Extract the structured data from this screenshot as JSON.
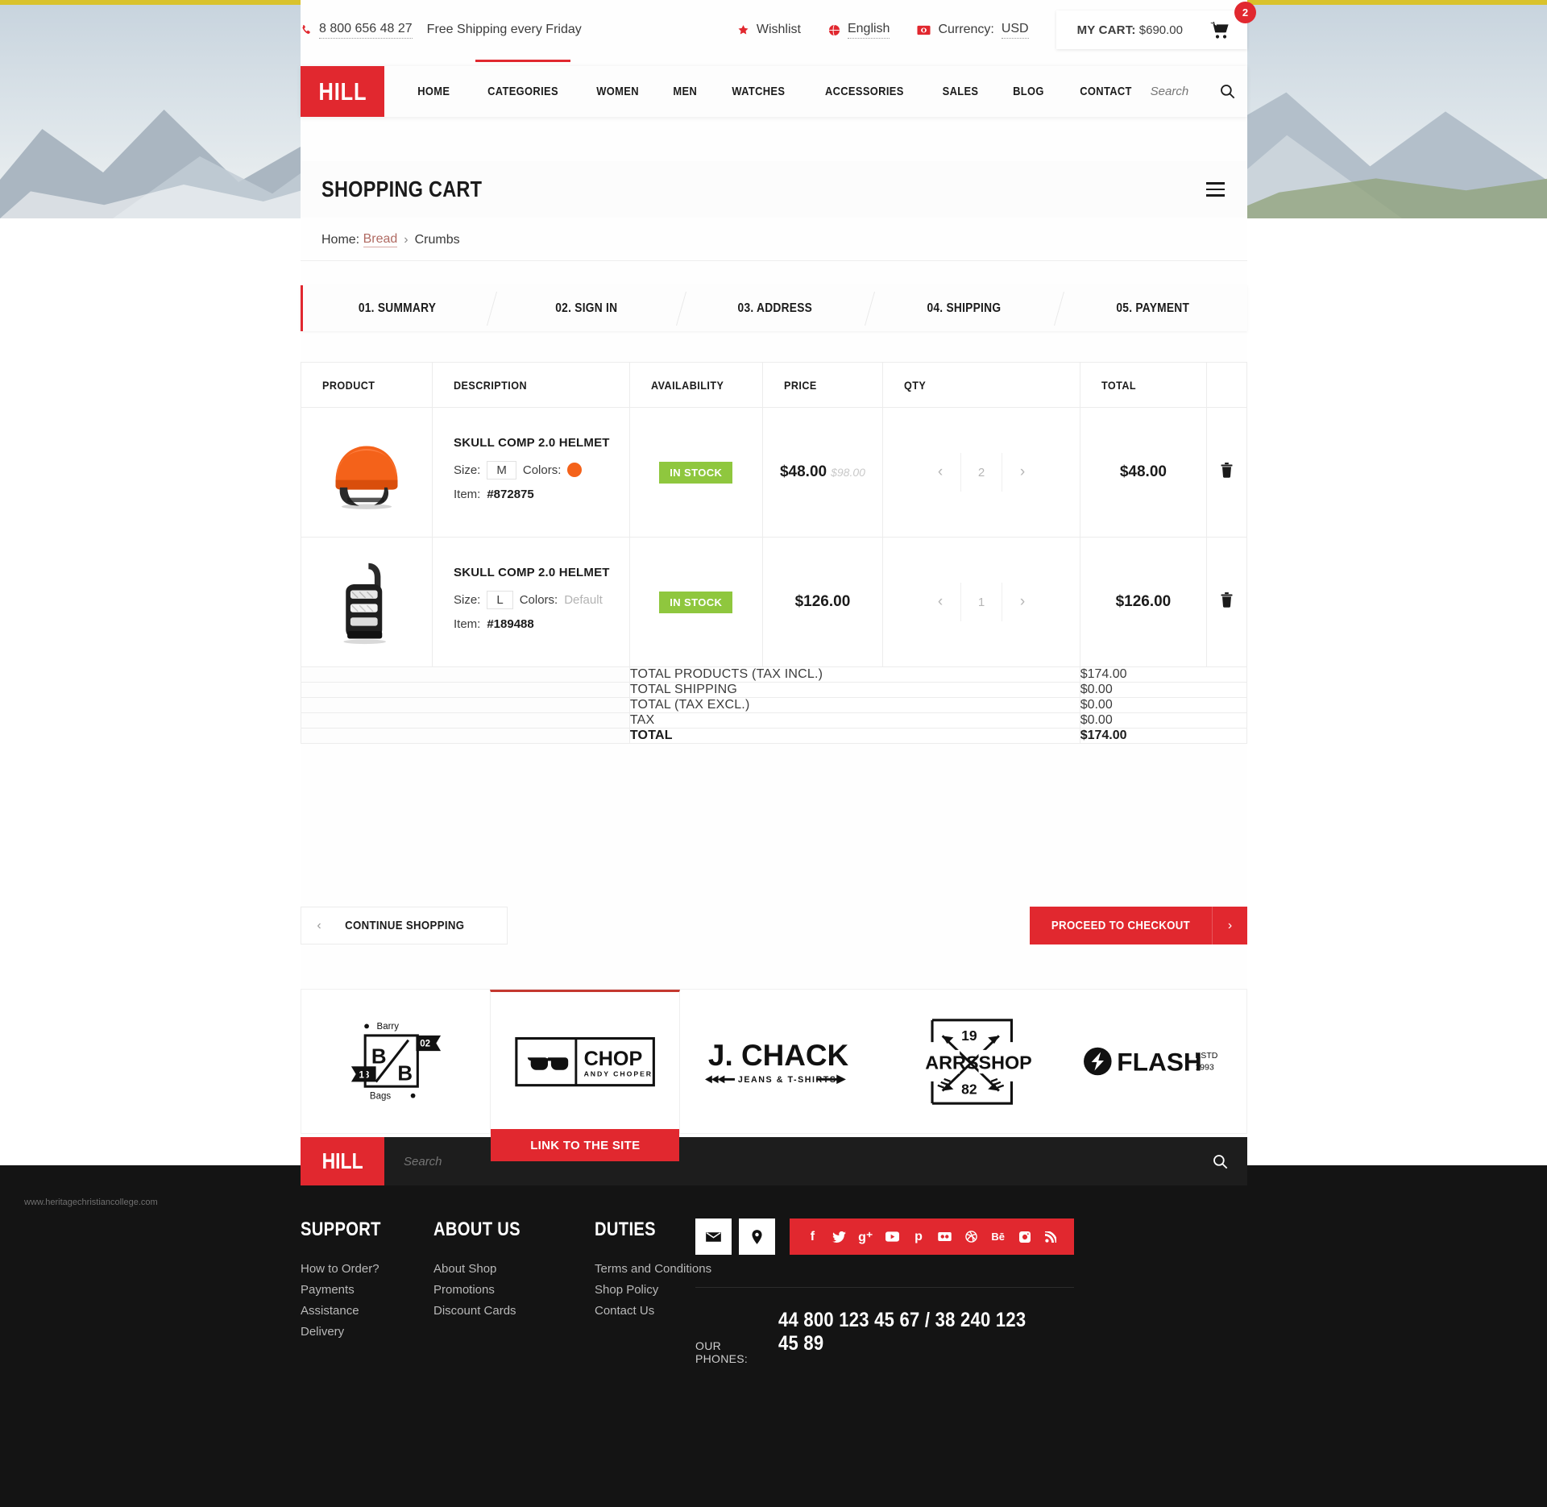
{
  "utility": {
    "phone": "8 800 656 48 27",
    "shipping_note": "Free Shipping every Friday",
    "wishlist": "Wishlist",
    "language": "English",
    "currency_label": "Currency:",
    "currency_value": "USD",
    "cart_label": "MY CART:",
    "cart_total": "$690.00",
    "cart_count": "2",
    "phone_icon": "phone-icon",
    "wishlist_icon": "star-icon",
    "language_icon": "globe-icon",
    "currency_icon": "money-icon",
    "cart_icon": "cart-icon"
  },
  "nav": {
    "logo": "HILL",
    "items": [
      {
        "label": "HOME",
        "active": false
      },
      {
        "label": "CATEGORIES",
        "active": true
      },
      {
        "label": "WOMEN",
        "active": false
      },
      {
        "label": "MEN",
        "active": false
      },
      {
        "label": "WATCHES",
        "active": false
      },
      {
        "label": "ACCESSORIES",
        "active": false
      },
      {
        "label": "SALES",
        "active": false
      },
      {
        "label": "BLOG",
        "active": false
      },
      {
        "label": "CONTACT",
        "active": false
      }
    ],
    "search_placeholder": "Search",
    "search_icon": "search-icon"
  },
  "page": {
    "title": "SHOPPING CART",
    "menu_icon": "hamburger-icon"
  },
  "breadcrumb": {
    "prefix": "Home:",
    "link": "Bread",
    "separator": "›",
    "current": "Crumbs"
  },
  "steps": [
    {
      "label": "01. SUMMARY",
      "active": true
    },
    {
      "label": "02. SIGN IN",
      "active": false
    },
    {
      "label": "03. ADDRESS",
      "active": false
    },
    {
      "label": "04. SHIPPING",
      "active": false
    },
    {
      "label": "05. PAYMENT",
      "active": false
    }
  ],
  "table": {
    "headers": [
      "PRODUCT",
      "DESCRIPTION",
      "AVAILABILITY",
      "PRICE",
      "QTY",
      "TOTAL",
      ""
    ],
    "rows": [
      {
        "image": "orange-helmet-image",
        "name": "SKULL COMP 2.0 HELMET",
        "size_label": "Size:",
        "size": "M",
        "colors_label": "Colors:",
        "color_value": "",
        "color_hex": "#f4621a",
        "item_label": "Item:",
        "item": "#872875",
        "availability": "IN STOCK",
        "price": "$48.00",
        "price_old": "$98.00",
        "qty": "2",
        "total": "$48.00",
        "delete_icon": "trash-icon"
      },
      {
        "image": "snowboard-binding-image",
        "name": "SKULL COMP 2.0 HELMET",
        "size_label": "Size:",
        "size": "L",
        "colors_label": "Colors:",
        "color_value": "Default",
        "color_hex": "",
        "item_label": "Item:",
        "item": "#189488",
        "availability": "IN STOCK",
        "price": "$126.00",
        "price_old": "",
        "qty": "1",
        "total": "$126.00",
        "delete_icon": "trash-icon"
      }
    ],
    "summary": [
      {
        "label": "TOTAL PRODUCTS (TAX INCL.)",
        "value": "$174.00",
        "bold": false
      },
      {
        "label": "TOTAL SHIPPING",
        "value": "$0.00",
        "bold": false
      },
      {
        "label": "TOTAL (TAX EXCL.)",
        "value": "$0.00",
        "bold": false
      },
      {
        "label": "TAX",
        "value": "$0.00",
        "bold": false
      },
      {
        "label": "TOTAL",
        "value": "$174.00",
        "bold": true
      }
    ]
  },
  "actions": {
    "continue": "CONTINUE SHOPPING",
    "continue_arrow": "‹",
    "checkout": "PROCEED TO CHECKOUT",
    "checkout_arrow": "›"
  },
  "brands": {
    "link_label": "LINK TO THE SITE",
    "items": [
      {
        "name": "barry-bags-logo",
        "text_top": "Barry",
        "text_bottom": "Bags",
        "num_left": "18",
        "num_right": "02",
        "letters": "B/B"
      },
      {
        "name": "chop-andy-choper-logo",
        "title": "CHOP",
        "subtitle": "ANDY CHOPER",
        "selected": true
      },
      {
        "name": "j-chack-logo",
        "title": "J. CHACK",
        "subtitle": "JEANS & T-SHIRTS"
      },
      {
        "name": "arrs-shop-logo",
        "left": "ARRS",
        "right": "SHOP",
        "top": "19",
        "bottom": "82"
      },
      {
        "name": "flash-logo",
        "title": "FLASH",
        "estd_label": "ESTD",
        "estd_year": "1993"
      }
    ]
  },
  "footer": {
    "columns": [
      {
        "heading": "SUPPORT",
        "links": [
          "How to Order?",
          "Payments",
          "Assistance",
          "Delivery"
        ]
      },
      {
        "heading": "ABOUT US",
        "links": [
          "About Shop",
          "Promotions",
          "Discount Cards"
        ]
      },
      {
        "heading": "DUTIES",
        "links": [
          "Terms and Conditions",
          "Shop Policy",
          "Contact Us"
        ]
      }
    ],
    "contact_icons": [
      "mail-icon",
      "location-pin-icon"
    ],
    "social_icons": [
      "facebook-icon",
      "twitter-icon",
      "google-plus-icon",
      "youtube-icon",
      "pinterest-icon",
      "flickr-icon",
      "dribbble-icon",
      "behance-icon",
      "instagram-icon",
      "rss-icon"
    ],
    "phones_label": "OUR PHONES:",
    "phones_value": "44 800 123 45 67  /  38 240 123 45 89",
    "logo": "HILL",
    "search_placeholder": "Search",
    "search_icon": "search-icon"
  },
  "watermark": "www.heritagechristiancollege.com"
}
